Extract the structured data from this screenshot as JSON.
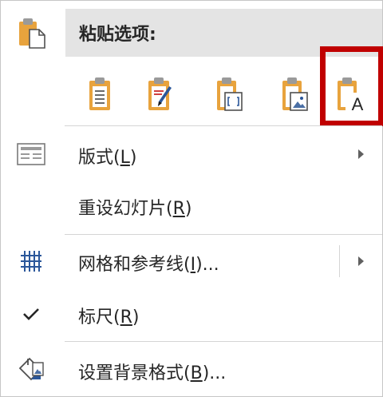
{
  "header": {
    "title": "粘贴选项:",
    "icon": "paste-icon"
  },
  "paste_options": [
    {
      "icon": "paste-keep-source-icon"
    },
    {
      "icon": "paste-use-destination-theme-icon"
    },
    {
      "icon": "paste-embed-icon"
    },
    {
      "icon": "paste-picture-icon"
    },
    {
      "icon": "paste-keep-text-only-icon",
      "glyph": "A",
      "highlighted": true
    }
  ],
  "menu": {
    "layout": {
      "label_prefix": "版式(",
      "key": "L",
      "label_suffix": ")",
      "icon": "layout-icon",
      "submenu": true
    },
    "reset_slide": {
      "label_prefix": "重设幻灯片(",
      "key": "R",
      "label_suffix": ")"
    },
    "grid_guides": {
      "label_prefix": "网格和参考线(",
      "key": "I",
      "label_suffix": ")...",
      "icon": "grid-icon",
      "submenu": true
    },
    "ruler": {
      "label_prefix": "标尺(",
      "key": "R",
      "label_suffix": ")",
      "icon": "checkmark-icon",
      "checked": true
    },
    "format_background": {
      "label_prefix": "设置背景格式(",
      "key": "B",
      "label_suffix": ")...",
      "icon": "format-background-icon"
    }
  },
  "colors": {
    "highlight": "#c00000",
    "clipboard_gold": "#e8a33d",
    "header_band": "#e4e4e4",
    "grid_blue": "#2b579a"
  }
}
